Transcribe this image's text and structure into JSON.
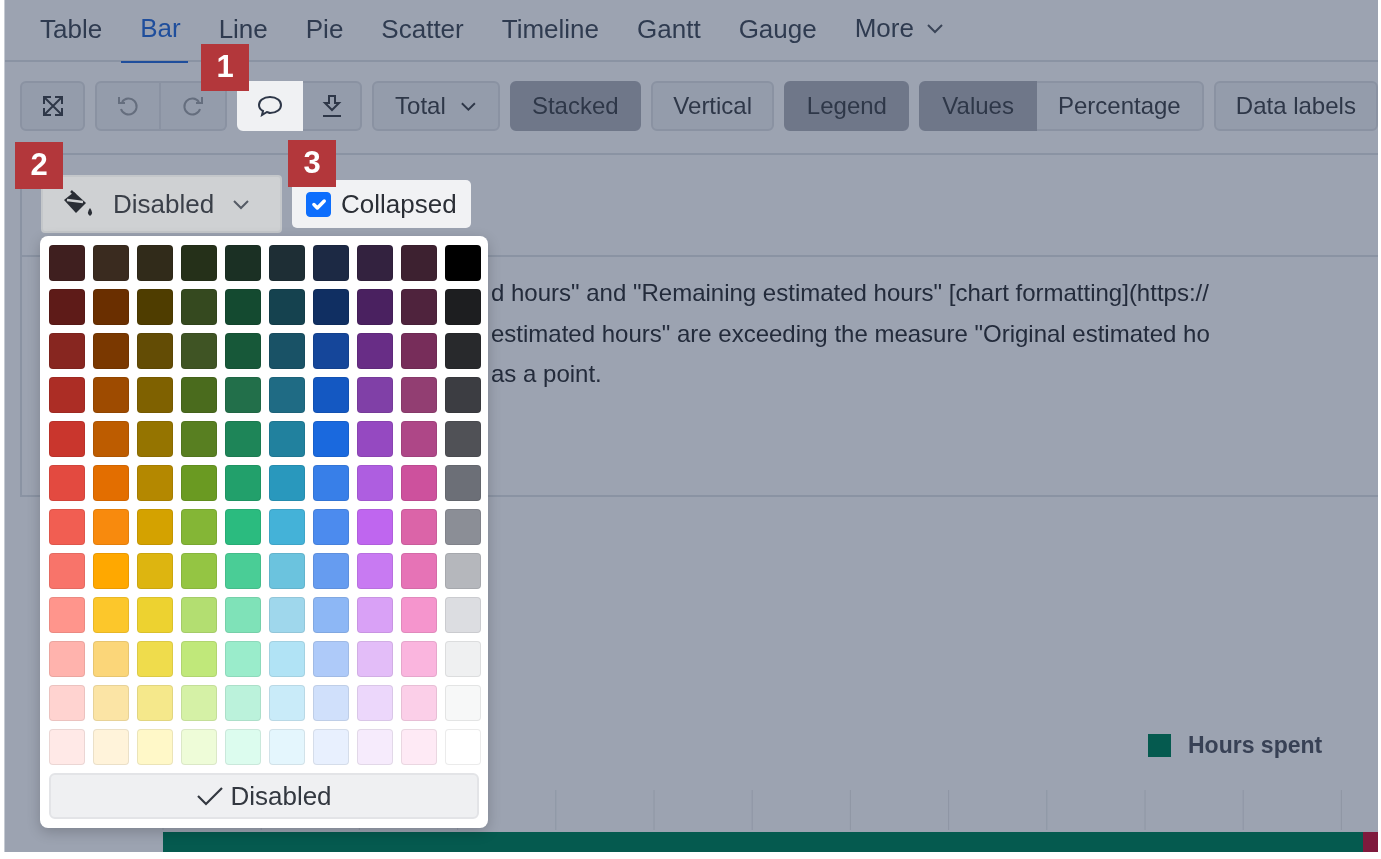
{
  "tabs": [
    {
      "label": "Table",
      "selected": false
    },
    {
      "label": "Bar",
      "selected": true
    },
    {
      "label": "Line",
      "selected": false
    },
    {
      "label": "Pie",
      "selected": false
    },
    {
      "label": "Scatter",
      "selected": false
    },
    {
      "label": "Timeline",
      "selected": false
    },
    {
      "label": "Gantt",
      "selected": false
    },
    {
      "label": "Gauge",
      "selected": false
    }
  ],
  "more_menu": {
    "label": "More"
  },
  "toolbar": {
    "undo": {
      "disabled": true
    },
    "redo": {
      "disabled": true
    },
    "comment": {
      "selected": true
    },
    "aggregate": {
      "label": "Total"
    },
    "toggles": [
      {
        "label": "Stacked",
        "selected": true
      },
      {
        "label": "Vertical",
        "selected": false
      },
      {
        "label": "Legend",
        "selected": true
      }
    ],
    "value_mode": [
      {
        "label": "Values",
        "selected": true
      },
      {
        "label": "Percentage",
        "selected": false
      }
    ],
    "data_labels": {
      "label": "Data labels",
      "selected": false
    }
  },
  "format_dropdown": {
    "label": "Disabled"
  },
  "collapsed_checkbox": {
    "label": "Collapsed",
    "checked": true
  },
  "description": {
    "lines": [
      "d hours\" and \"Remaining estimated hours\" [chart formatting](https://",
      "estimated hours\" are exceeding the measure \"Original estimated ho",
      "as a point."
    ]
  },
  "legend": {
    "items": [
      {
        "label": "Hours spent",
        "color": "#055a4f"
      }
    ]
  },
  "palette": {
    "rows": [
      {
        "swatches": [
          {
            "color": "#3f1f1f"
          },
          {
            "color": "#3a2b1f"
          },
          {
            "color": "#312b1a"
          },
          {
            "color": "#253019"
          },
          {
            "color": "#1b3024"
          },
          {
            "color": "#1e2e35"
          },
          {
            "color": "#1c2944"
          },
          {
            "color": "#33223f"
          },
          {
            "color": "#3d2130"
          },
          {
            "color": "#000000"
          }
        ]
      },
      {
        "swatches": [
          {
            "color": "#5e1b18"
          },
          {
            "color": "#6a2f00"
          },
          {
            "color": "#4f3d00"
          },
          {
            "color": "#35491f"
          },
          {
            "color": "#144a30"
          },
          {
            "color": "#15424f"
          },
          {
            "color": "#102f62"
          },
          {
            "color": "#4a2160"
          },
          {
            "color": "#4f233d"
          },
          {
            "color": "#1d1e20"
          }
        ]
      },
      {
        "swatches": [
          {
            "color": "#872620"
          },
          {
            "color": "#7a3800"
          },
          {
            "color": "#634c05"
          },
          {
            "color": "#3f5424"
          },
          {
            "color": "#175839"
          },
          {
            "color": "#195266"
          },
          {
            "color": "#15469a"
          },
          {
            "color": "#682d86"
          },
          {
            "color": "#772d5a"
          },
          {
            "color": "#28292c"
          }
        ]
      },
      {
        "swatches": [
          {
            "color": "#ac2d25"
          },
          {
            "color": "#9e4b00"
          },
          {
            "color": "#7f6100"
          },
          {
            "color": "#4a6b1d"
          },
          {
            "color": "#226f4a"
          },
          {
            "color": "#1f6b84"
          },
          {
            "color": "#1458c2"
          },
          {
            "color": "#8040a7"
          },
          {
            "color": "#923e72"
          },
          {
            "color": "#3c3d42"
          }
        ]
      },
      {
        "swatches": [
          {
            "color": "#c9362d"
          },
          {
            "color": "#bd5c00"
          },
          {
            "color": "#957400"
          },
          {
            "color": "#587f21"
          },
          {
            "color": "#1e8558"
          },
          {
            "color": "#21819e"
          },
          {
            "color": "#1a69de"
          },
          {
            "color": "#9549c1"
          },
          {
            "color": "#ae4787"
          },
          {
            "color": "#505156"
          }
        ]
      },
      {
        "swatches": [
          {
            "color": "#e34a40"
          },
          {
            "color": "#e36e00"
          },
          {
            "color": "#b48800"
          },
          {
            "color": "#6a9a22"
          },
          {
            "color": "#22a06b"
          },
          {
            "color": "#2998bd"
          },
          {
            "color": "#387fe8"
          },
          {
            "color": "#ae5ee0"
          },
          {
            "color": "#cd519d"
          },
          {
            "color": "#6c6f77"
          }
        ]
      },
      {
        "swatches": [
          {
            "color": "#f15e52"
          },
          {
            "color": "#f88a0d"
          },
          {
            "color": "#d4a200"
          },
          {
            "color": "#84b636"
          },
          {
            "color": "#2bbb7f"
          },
          {
            "color": "#44b2d8"
          },
          {
            "color": "#4c8bee"
          },
          {
            "color": "#bf66ef"
          },
          {
            "color": "#db64a8"
          },
          {
            "color": "#8b8e96"
          }
        ]
      },
      {
        "swatches": [
          {
            "color": "#f8746a"
          },
          {
            "color": "#ffa800"
          },
          {
            "color": "#ddb510"
          },
          {
            "color": "#94c543"
          },
          {
            "color": "#4acd96"
          },
          {
            "color": "#6bc3de"
          },
          {
            "color": "#669cf0"
          },
          {
            "color": "#c87af2"
          },
          {
            "color": "#e673b6"
          },
          {
            "color": "#b5b7bc"
          }
        ]
      },
      {
        "swatches": [
          {
            "color": "#ff958c"
          },
          {
            "color": "#fcc72b"
          },
          {
            "color": "#edd230"
          },
          {
            "color": "#b3de71"
          },
          {
            "color": "#7fe2b8"
          },
          {
            "color": "#9fd7ec"
          },
          {
            "color": "#8db7f5"
          },
          {
            "color": "#d9a1f6"
          },
          {
            "color": "#f595cd"
          },
          {
            "color": "#dcdde1"
          }
        ]
      },
      {
        "swatches": [
          {
            "color": "#ffb3ad"
          },
          {
            "color": "#fbd679"
          },
          {
            "color": "#efdc4c"
          },
          {
            "color": "#c0e87a"
          },
          {
            "color": "#9aeccb"
          },
          {
            "color": "#b1e3f5"
          },
          {
            "color": "#aecaf9"
          },
          {
            "color": "#e3bdf8"
          },
          {
            "color": "#fab5de"
          },
          {
            "color": "#eff0f1"
          }
        ]
      },
      {
        "swatches": [
          {
            "color": "#ffd3d0"
          },
          {
            "color": "#fbe4a5"
          },
          {
            "color": "#f5e88b"
          },
          {
            "color": "#d5f1a6"
          },
          {
            "color": "#bbf2db"
          },
          {
            "color": "#c9ebf9"
          },
          {
            "color": "#d0e0fb"
          },
          {
            "color": "#ecd7fb"
          },
          {
            "color": "#fbcfe8"
          },
          {
            "color": "#f7f8f8"
          }
        ]
      },
      {
        "swatches": [
          {
            "color": "#ffe9e7"
          },
          {
            "color": "#fff3da"
          },
          {
            "color": "#fff8c8"
          },
          {
            "color": "#eefcd8"
          },
          {
            "color": "#dcfcee"
          },
          {
            "color": "#e4f6fd"
          },
          {
            "color": "#e8f0fe"
          },
          {
            "color": "#f6ebfc"
          },
          {
            "color": "#feeaf5"
          },
          {
            "color": "#ffffff"
          }
        ]
      }
    ],
    "disabled_option": {
      "label": "Disabled",
      "selected": true
    }
  },
  "callouts": [
    {
      "label": "1"
    },
    {
      "label": "2"
    },
    {
      "label": "3"
    }
  ]
}
